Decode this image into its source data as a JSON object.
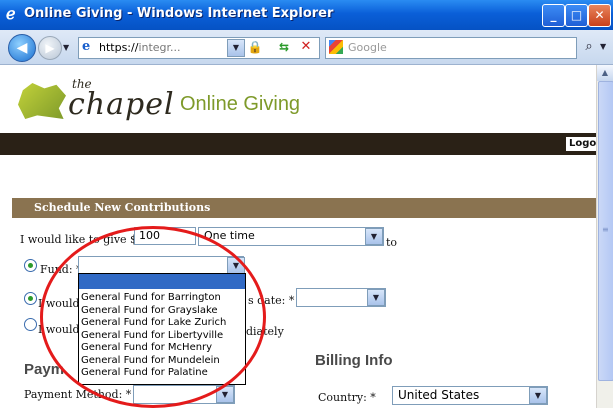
{
  "window": {
    "title": "Online Giving - Windows Internet Explorer",
    "min_glyph": "_",
    "max_glyph": "□",
    "close_glyph": "✕"
  },
  "nav": {
    "back_glyph": "◀",
    "forward_glyph": "▶",
    "url_protocol": "https://",
    "url_rest": "integr...",
    "search_placeholder": "Google"
  },
  "site": {
    "logo_the": "the",
    "logo_name": "chapel",
    "subtitle": "Online Giving",
    "logout_label": "Logo"
  },
  "form": {
    "section_title": "Schedule New Contributions",
    "give_label": "I would like to give $ :",
    "amount_value": "100",
    "frequency_value": "One time",
    "to_label": "to",
    "fund_label": "Fund: *",
    "fund_value": "",
    "date_label_left": "I would l",
    "date_label_right": "s date: *",
    "date_value": "",
    "now_label_left": "I would l",
    "now_label_right": "diately",
    "payment_heading": "Paym",
    "billing_heading": "Billing Info",
    "payment_method_label": "Payment Method: *",
    "payment_method_value": "",
    "country_label": "Country: *",
    "country_value": "United States"
  },
  "fund_options": [
    "General Fund for Barrington",
    "General Fund for Grayslake",
    "General Fund for Lake Zurich",
    "General Fund for Libertyville",
    "General Fund for McHenry",
    "General Fund for Mundelein",
    "General Fund for Palatine"
  ],
  "colors": {
    "titlebar": "#0a5fd8",
    "section_header": "#8a7350",
    "dark_bar": "#2a2116",
    "brand_green": "#7e9a2a",
    "annotation": "#e41b1b"
  }
}
